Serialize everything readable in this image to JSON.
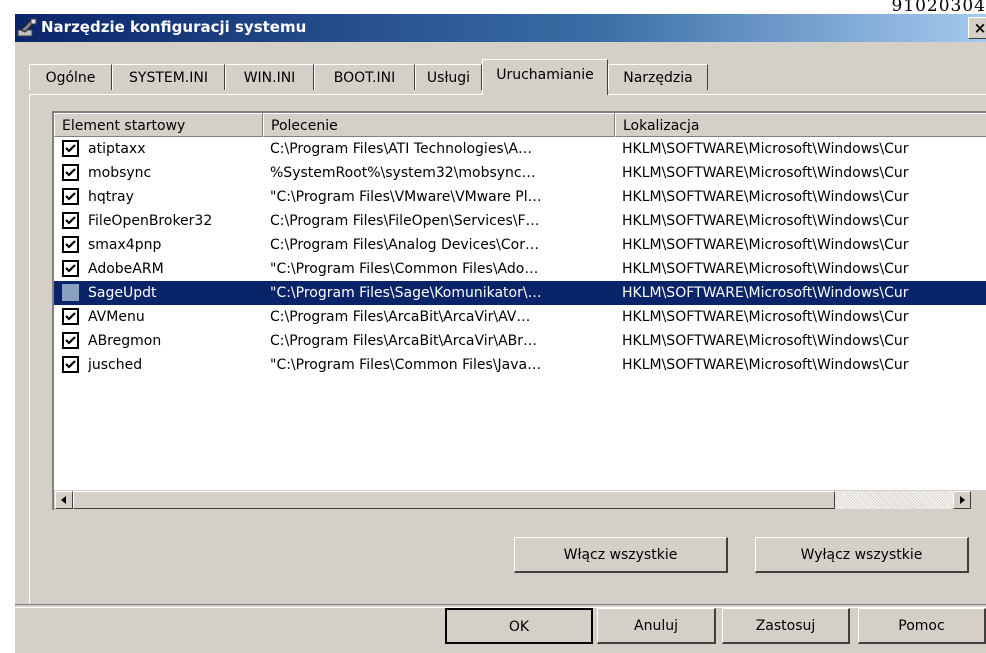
{
  "corner_text": "91020304",
  "window": {
    "title": "Narzędzie konfiguracji systemu",
    "close_label": "×"
  },
  "tabs": [
    {
      "label": "Ogólne",
      "active": false
    },
    {
      "label": "SYSTEM.INI",
      "active": false
    },
    {
      "label": "WIN.INI",
      "active": false
    },
    {
      "label": "BOOT.INI",
      "active": false
    },
    {
      "label": "Usługi",
      "active": false
    },
    {
      "label": "Uruchamianie",
      "active": true
    },
    {
      "label": "Narzędzia",
      "active": false
    }
  ],
  "startup_list": {
    "columns": [
      "Element startowy",
      "Polecenie",
      "Lokalizacja"
    ],
    "rows": [
      {
        "checked": true,
        "selected": false,
        "name": "atiptaxx",
        "command": "C:\\Program Files\\ATI Technologies\\A…",
        "location": "HKLM\\SOFTWARE\\Microsoft\\Windows\\Cur"
      },
      {
        "checked": true,
        "selected": false,
        "name": "mobsync",
        "command": "%SystemRoot%\\system32\\mobsync…",
        "location": "HKLM\\SOFTWARE\\Microsoft\\Windows\\Cur"
      },
      {
        "checked": true,
        "selected": false,
        "name": "hqtray",
        "command": "\"C:\\Program Files\\VMware\\VMware Pl…",
        "location": "HKLM\\SOFTWARE\\Microsoft\\Windows\\Cur"
      },
      {
        "checked": true,
        "selected": false,
        "name": "FileOpenBroker32",
        "command": "C:\\Program Files\\FileOpen\\Services\\F…",
        "location": "HKLM\\SOFTWARE\\Microsoft\\Windows\\Cur"
      },
      {
        "checked": true,
        "selected": false,
        "name": "smax4pnp",
        "command": "C:\\Program Files\\Analog Devices\\Cor…",
        "location": "HKLM\\SOFTWARE\\Microsoft\\Windows\\Cur"
      },
      {
        "checked": true,
        "selected": false,
        "name": "AdobeARM",
        "command": "\"C:\\Program Files\\Common Files\\Ado…",
        "location": "HKLM\\SOFTWARE\\Microsoft\\Windows\\Cur"
      },
      {
        "checked": false,
        "selected": true,
        "name": "SageUpdt",
        "command": "\"C:\\Program Files\\Sage\\Komunikator\\…",
        "location": "HKLM\\SOFTWARE\\Microsoft\\Windows\\Cur"
      },
      {
        "checked": true,
        "selected": false,
        "name": "AVMenu",
        "command": "C:\\Program Files\\ArcaBit\\ArcaVir\\AV…",
        "location": "HKLM\\SOFTWARE\\Microsoft\\Windows\\Cur"
      },
      {
        "checked": true,
        "selected": false,
        "name": "ABregmon",
        "command": "C:\\Program Files\\ArcaBit\\ArcaVir\\ABr…",
        "location": "HKLM\\SOFTWARE\\Microsoft\\Windows\\Cur"
      },
      {
        "checked": true,
        "selected": false,
        "name": "jusched",
        "command": "\"C:\\Program Files\\Common Files\\Java…",
        "location": "HKLM\\SOFTWARE\\Microsoft\\Windows\\Cur"
      }
    ]
  },
  "actions": {
    "enable_all": "Włącz wszystkie",
    "disable_all": "Wyłącz wszystkie"
  },
  "dialog_buttons": {
    "ok": "OK",
    "cancel": "Anuluj",
    "apply": "Zastosuj",
    "help": "Pomoc"
  },
  "colors": {
    "selection": "#0a246a",
    "face": "#d4d0c8"
  }
}
